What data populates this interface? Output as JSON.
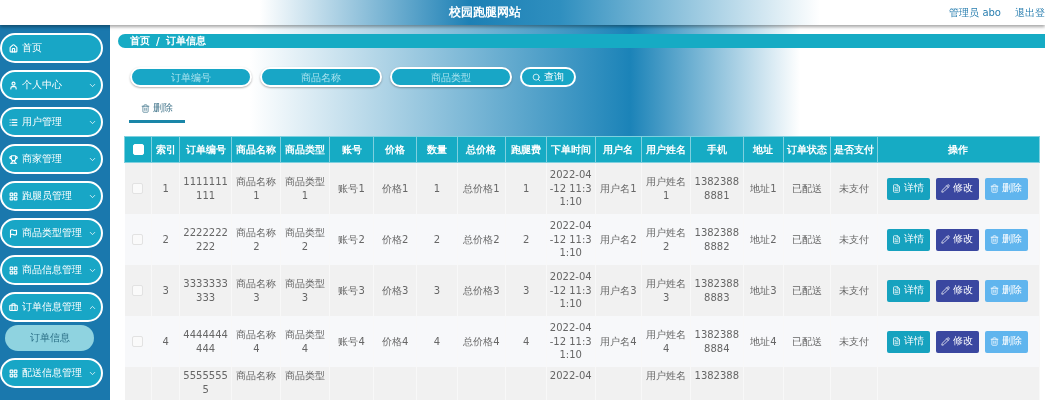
{
  "header": {
    "title": "校园跑腿网站",
    "user": "管理员 abo",
    "logout": "退出登"
  },
  "sidebar": {
    "items": [
      {
        "label": "首页",
        "kind": "link"
      },
      {
        "label": "个人中心",
        "kind": "menu",
        "expanded": false
      },
      {
        "label": "用户管理",
        "kind": "menu",
        "expanded": false
      },
      {
        "label": "商家管理",
        "kind": "menu",
        "expanded": false
      },
      {
        "label": "跑腿员管理",
        "kind": "menu",
        "expanded": false
      },
      {
        "label": "商品类型管理",
        "kind": "menu",
        "expanded": false
      },
      {
        "label": "商品信息管理",
        "kind": "menu",
        "expanded": false
      },
      {
        "label": "订单信息管理",
        "kind": "menu",
        "expanded": true,
        "children": [
          {
            "label": "订单信息",
            "selected": true
          }
        ]
      },
      {
        "label": "配送信息管理",
        "kind": "menu",
        "expanded": false
      }
    ]
  },
  "breadcrumb": {
    "items": [
      "首页",
      "订单信息"
    ],
    "separator": "/"
  },
  "search": {
    "fields": [
      {
        "placeholder": "订单编号"
      },
      {
        "placeholder": "商品名称"
      },
      {
        "placeholder": "商品类型"
      }
    ],
    "button": "查询"
  },
  "toolbar": {
    "delete_button": "删除"
  },
  "table": {
    "select_all": {
      "checked": false
    },
    "columns": [
      "索引",
      "订单编号",
      "商品名称",
      "商品类型",
      "账号",
      "价格",
      "数量",
      "总价格",
      "跑腿费",
      "下单时间",
      "用户名",
      "用户姓名",
      "手机",
      "地址",
      "订单状态",
      "是否支付",
      "操作"
    ],
    "rows": [
      {
        "checked": false,
        "cells": [
          "1",
          "1111111111",
          "商品名称1",
          "商品类型1",
          "账号1",
          "价格1",
          "1",
          "总价格1",
          "1",
          "2022-04-12 11:31:10",
          "用户名1",
          "用户姓名1",
          "13823888881",
          "地址1",
          "已配送",
          "未支付"
        ],
        "actions": [
          {
            "label": "详情",
            "kind": "detail"
          },
          {
            "label": "修改",
            "kind": "edit"
          },
          {
            "label": "删除",
            "kind": "delete"
          }
        ]
      },
      {
        "checked": false,
        "cells": [
          "2",
          "2222222222",
          "商品名称2",
          "商品类型2",
          "账号2",
          "价格2",
          "2",
          "总价格2",
          "2",
          "2022-04-12 11:31:10",
          "用户名2",
          "用户姓名2",
          "13823888882",
          "地址2",
          "已配送",
          "未支付"
        ],
        "actions": [
          {
            "label": "详情",
            "kind": "detail"
          },
          {
            "label": "修改",
            "kind": "edit"
          },
          {
            "label": "删除",
            "kind": "delete"
          }
        ]
      },
      {
        "checked": false,
        "cells": [
          "3",
          "3333333333",
          "商品名称3",
          "商品类型3",
          "账号3",
          "价格3",
          "3",
          "总价格3",
          "3",
          "2022-04-12 11:31:10",
          "用户名3",
          "用户姓名3",
          "13823888883",
          "地址3",
          "已配送",
          "未支付"
        ],
        "actions": [
          {
            "label": "详情",
            "kind": "detail"
          },
          {
            "label": "修改",
            "kind": "edit"
          },
          {
            "label": "删除",
            "kind": "delete"
          }
        ]
      },
      {
        "checked": false,
        "cells": [
          "4",
          "4444444444",
          "商品名称4",
          "商品类型4",
          "账号4",
          "价格4",
          "4",
          "总价格4",
          "4",
          "2022-04-12 11:31:10",
          "用户名4",
          "用户姓名4",
          "13823888884",
          "地址4",
          "已配送",
          "未支付"
        ],
        "actions": [
          {
            "label": "详情",
            "kind": "detail"
          },
          {
            "label": "修改",
            "kind": "edit"
          },
          {
            "label": "删除",
            "kind": "delete"
          }
        ]
      },
      {
        "cells": [
          null,
          "55555555",
          "商品名称",
          "商品类型",
          null,
          null,
          null,
          null,
          null,
          "2022-04",
          null,
          "用户姓名",
          "1382388",
          null,
          null,
          null
        ]
      }
    ]
  }
}
